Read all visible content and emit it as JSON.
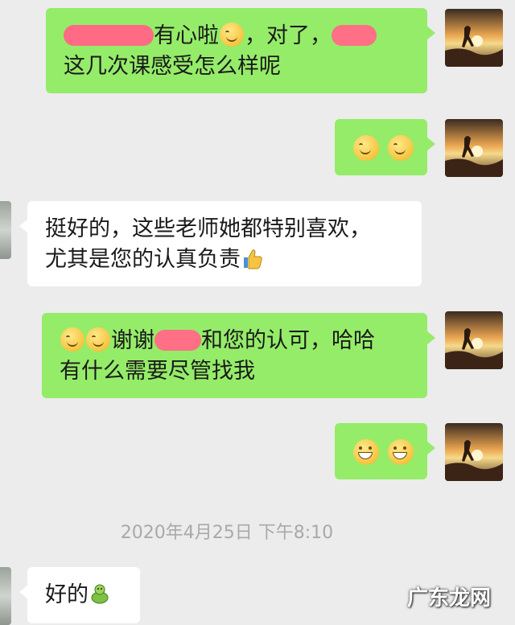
{
  "messages": [
    {
      "id": "m1",
      "sender": "me",
      "line1_a": "",
      "line1_b": "有心啦",
      "line1_c": "，对了，",
      "line2": "这几次课感受怎么样呢"
    },
    {
      "id": "m2",
      "sender": "me",
      "emoji": [
        "smile",
        "smile"
      ]
    },
    {
      "id": "m3",
      "sender": "other",
      "line1": "挺好的，这些老师她都特别喜欢，",
      "line2": "尤其是您的认真负责"
    },
    {
      "id": "m4",
      "sender": "me",
      "line1_a": "谢谢",
      "line1_b": "和您的认可，哈哈",
      "line2": "有什么需要尽管找我"
    },
    {
      "id": "m5",
      "sender": "me",
      "emoji": [
        "grin",
        "grin"
      ]
    },
    {
      "id": "m6",
      "sender": "other",
      "line1": "好的"
    }
  ],
  "timestamp": "2020年4月25日 下午8:10",
  "watermark": "广东龙网",
  "colors": {
    "my_bubble": "#95ec69",
    "their_bubble": "#ffffff",
    "background": "#ececec",
    "redaction": "#ff6f86"
  }
}
